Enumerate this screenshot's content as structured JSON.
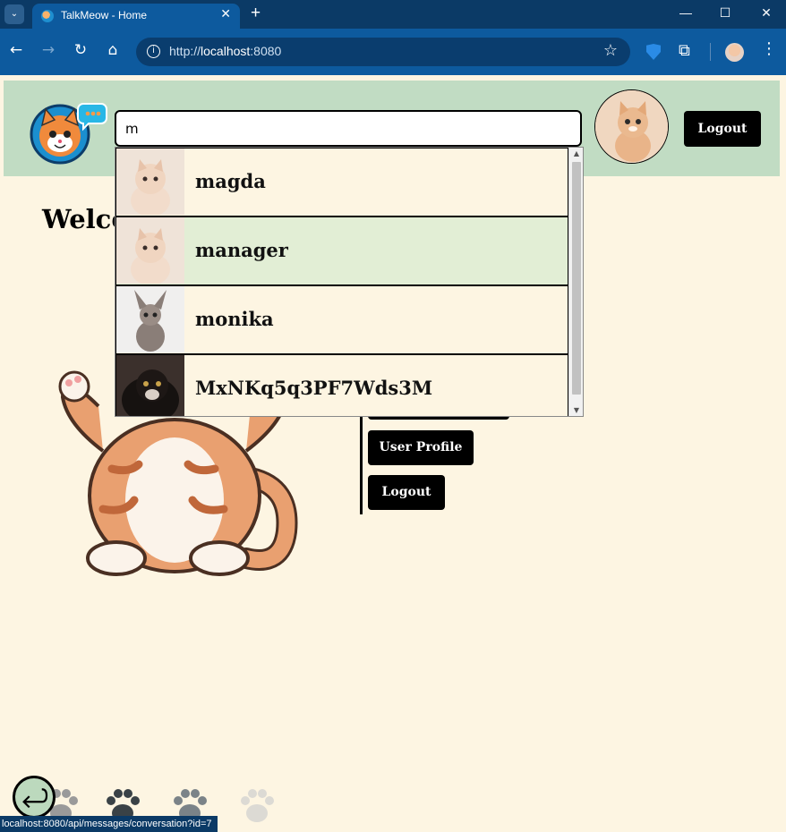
{
  "browser": {
    "tab_title": "TalkMeow - Home",
    "tab_close": "✕",
    "new_tab": "+",
    "url_scheme_host": "http://",
    "url_host": "localhost",
    "url_port": ":8080",
    "window_controls": [
      "—",
      "☐",
      "✕"
    ]
  },
  "header": {
    "search_value": "m",
    "logout_label": "Logout"
  },
  "welcome_text": "Welco",
  "side_menu": {
    "user_profile_label": "User Profile",
    "logout_label": "Logout"
  },
  "search_results": [
    {
      "name": "magda",
      "avatar": "cream-cat"
    },
    {
      "name": "manager",
      "avatar": "cream-cat",
      "highlighted": true
    },
    {
      "name": "monika",
      "avatar": "sphynx-cat"
    },
    {
      "name": "MxNKq5q3PF7Wds3M",
      "avatar": "black-longhair-cat"
    }
  ],
  "status_bar_url": "localhost:8080/api/messages/conversation?id=7",
  "colors": {
    "header_bg": "#c1dcc3",
    "page_bg": "#fdf5e2",
    "highlight_row": "#e2eed5",
    "button_bg": "#000000"
  }
}
